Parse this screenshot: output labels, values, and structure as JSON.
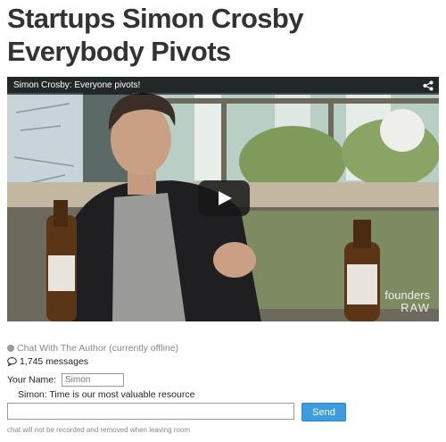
{
  "page": {
    "title": "Startups Simon Crosby Everybody Pivots"
  },
  "video": {
    "title": "Simon Crosby: Everyone pivots!",
    "share_icon": "share-icon",
    "play_icon": "play-icon",
    "watermark_line1": "founders",
    "watermark_line2": "RAW"
  },
  "chat": {
    "status": "Chat With The Author (currently offline)",
    "message_count": "1,745 messages",
    "name_label": "Your Name:",
    "name_placeholder": "Simon",
    "last_message": "Simon: Time is our most valuable resource",
    "input_value": "",
    "send_label": "Send",
    "disclaimer": "chat will not be recorded and removed when leaving room"
  },
  "colors": {
    "send_button": "#3c9ce0",
    "title_text": "#333333",
    "status_dot": "#9a9a9a"
  }
}
